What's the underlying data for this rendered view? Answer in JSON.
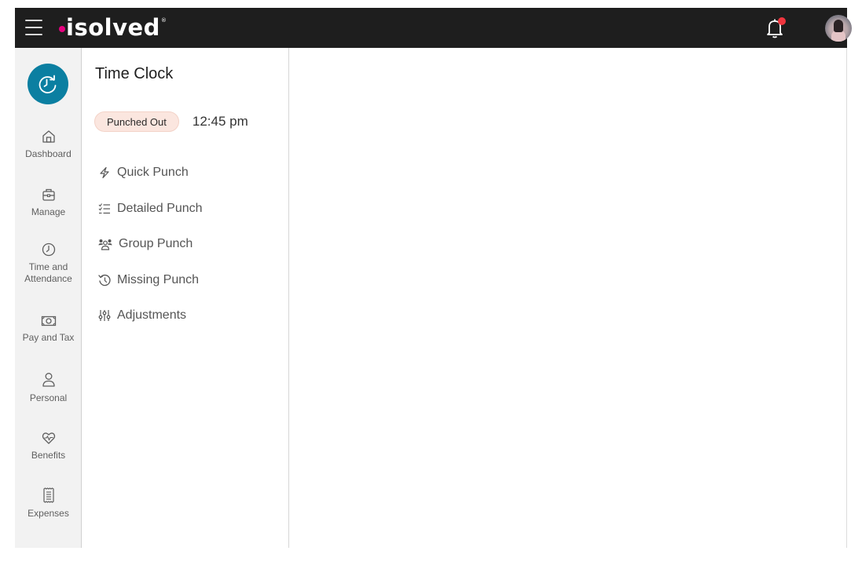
{
  "header": {
    "menu_icon": "hamburger-menu-icon",
    "logo_text": "isolved",
    "logo_registered": "®",
    "notification_icon": "bell-icon",
    "notification_badge_color": "#f0353e",
    "avatar": "user-avatar"
  },
  "colors": {
    "header_bg": "#1e1e1e",
    "accent": "#0b7fa1",
    "logo_dot": "#e5007e",
    "badge_bg": "#fbe6df"
  },
  "sidebar": {
    "app_icon": "time-clock-icon",
    "items": [
      {
        "label": "Dashboard",
        "icon": "home-icon"
      },
      {
        "label": "Manage",
        "icon": "briefcase-icon"
      },
      {
        "label": "Time and Attendance",
        "icon": "clock-icon"
      },
      {
        "label": "Pay and Tax",
        "icon": "money-icon"
      },
      {
        "label": "Personal",
        "icon": "person-icon"
      },
      {
        "label": "Benefits",
        "icon": "heart-pulse-icon"
      },
      {
        "label": "Expenses",
        "icon": "receipt-icon"
      }
    ]
  },
  "panel": {
    "title": "Time Clock",
    "status_badge": "Punched Out",
    "status_time": "12:45 pm",
    "menu": [
      {
        "label": "Quick Punch",
        "icon": "lightning-icon"
      },
      {
        "label": "Detailed Punch",
        "icon": "checklist-icon"
      },
      {
        "label": "Group Punch",
        "icon": "group-icon"
      },
      {
        "label": "Missing Punch",
        "icon": "history-icon"
      },
      {
        "label": "Adjustments",
        "icon": "sliders-icon"
      }
    ]
  }
}
